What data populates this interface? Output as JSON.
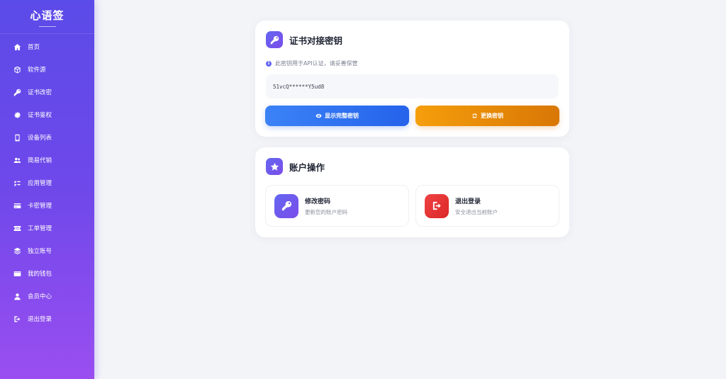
{
  "app": {
    "brand": "心语签"
  },
  "sidebar": {
    "items": [
      {
        "label": "首页",
        "icon": "home-icon"
      },
      {
        "label": "软件源",
        "icon": "box-icon"
      },
      {
        "label": "证书改密",
        "icon": "key-icon"
      },
      {
        "label": "证书鉴权",
        "icon": "gear-icon"
      },
      {
        "label": "设备列表",
        "icon": "phone-icon"
      },
      {
        "label": "简易代销",
        "icon": "users-icon"
      },
      {
        "label": "应用管理",
        "icon": "apps-icon"
      },
      {
        "label": "卡密管理",
        "icon": "card-icon"
      },
      {
        "label": "工单管理",
        "icon": "ticket-icon"
      },
      {
        "label": "独立账号",
        "icon": "layers-icon"
      },
      {
        "label": "我的钱包",
        "icon": "wallet-icon"
      },
      {
        "label": "会员中心",
        "icon": "user-icon"
      },
      {
        "label": "退出登录",
        "icon": "logout-icon"
      }
    ]
  },
  "key_card": {
    "title": "证书对接密钥",
    "notice": "此密钥用于API认证，请妥善保管",
    "key_value": "51vcQ******Y5ud8",
    "show_button": "显示完整密钥",
    "change_button": "更换密钥"
  },
  "account_card": {
    "title": "账户操作",
    "change_password": {
      "title": "修改密码",
      "subtitle": "更新您的账户密码"
    },
    "logout": {
      "title": "退出登录",
      "subtitle": "安全退出当前账户"
    }
  },
  "colors": {
    "sidebar_top": "#5b4be8",
    "sidebar_bottom": "#9a4ef0",
    "primary_blue": "#2563eb",
    "accent_orange": "#f59e0b",
    "danger_red": "#ef4444",
    "icon_purple": "#6366f1"
  }
}
